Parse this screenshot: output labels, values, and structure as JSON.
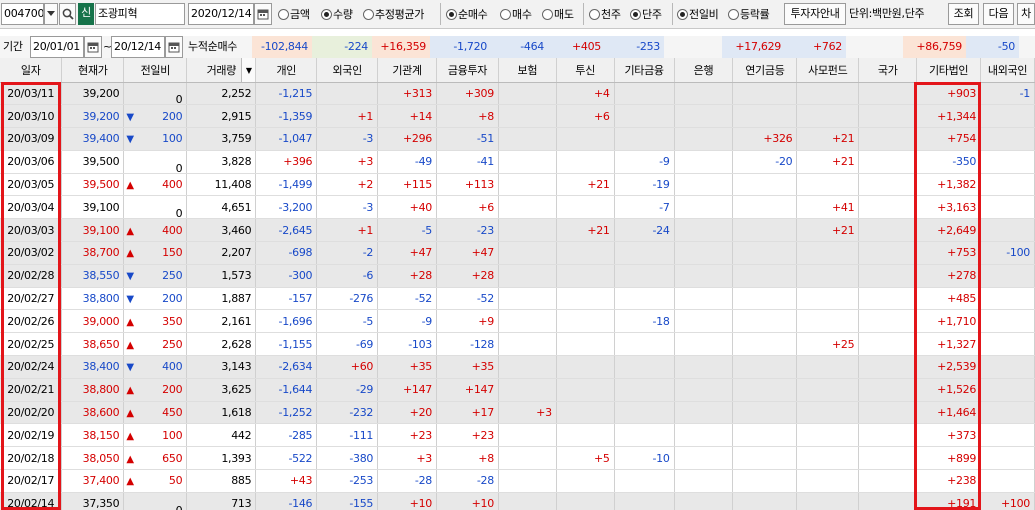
{
  "toolbar": {
    "code": "004700",
    "stock_badge": "신",
    "stock_name": "조광피혁",
    "date": "2020/12/14",
    "unit_options": [
      {
        "label": "금액",
        "on": false
      },
      {
        "label": "수량",
        "on": true
      },
      {
        "label": "추정평균가",
        "on": false
      }
    ],
    "trade_options": [
      {
        "label": "순매수",
        "on": true
      },
      {
        "label": "매수",
        "on": false
      },
      {
        "label": "매도",
        "on": false
      }
    ],
    "qty_options": [
      {
        "label": "천주",
        "on": false
      },
      {
        "label": "단주",
        "on": true
      }
    ],
    "compare_options": [
      {
        "label": "전일비",
        "on": true
      },
      {
        "label": "등락률",
        "on": false
      }
    ],
    "investor_info_button": "투자자안내",
    "unit_text": "단위:백만원,단주",
    "search_button": "조회",
    "next_button": "다음",
    "chart_button": "차"
  },
  "period": {
    "label": "기간",
    "from": "20/01/01",
    "tilde": "~",
    "to": "20/12/14",
    "cumulative_label": "누적순매수",
    "totals": [
      "-102,844",
      "-224",
      "+16,359",
      "-1,720",
      "-464",
      "+405",
      "-253",
      "",
      "+17,629",
      "+762",
      "",
      "+86,759",
      "-50"
    ]
  },
  "columns": [
    "일자",
    "현재가",
    "전일비",
    "거래량",
    "개인",
    "외국인",
    "기관계",
    "금융투자",
    "보험",
    "투신",
    "기타금융",
    "은행",
    "연기금등",
    "사모펀드",
    "국가",
    "기타법인",
    "내외국인"
  ],
  "rows": [
    [
      "20/03/11",
      "39,200",
      "",
      "0",
      "2,252",
      "-1,215",
      "",
      "+313",
      "+309",
      "",
      "+4",
      "",
      "",
      "",
      "",
      "",
      "+903",
      "-1"
    ],
    [
      "20/03/10",
      "39,200",
      "dn",
      "200",
      "2,915",
      "-1,359",
      "+1",
      "+14",
      "+8",
      "",
      "+6",
      "",
      "",
      "",
      "",
      "",
      "+1,344",
      ""
    ],
    [
      "20/03/09",
      "39,400",
      "dn",
      "100",
      "3,759",
      "-1,047",
      "-3",
      "+296",
      "-51",
      "",
      "",
      "",
      "",
      "+326",
      "+21",
      "",
      "+754",
      ""
    ],
    [
      "20/03/06",
      "39,500",
      "",
      "0",
      "3,828",
      "+396",
      "+3",
      "-49",
      "-41",
      "",
      "",
      "-9",
      "",
      "-20",
      "+21",
      "",
      "-350",
      ""
    ],
    [
      "20/03/05",
      "39,500",
      "up",
      "400",
      "11,408",
      "-1,499",
      "+2",
      "+115",
      "+113",
      "",
      "+21",
      "-19",
      "",
      "",
      "",
      "",
      "+1,382",
      ""
    ],
    [
      "20/03/04",
      "39,100",
      "",
      "0",
      "4,651",
      "-3,200",
      "-3",
      "+40",
      "+6",
      "",
      "",
      "-7",
      "",
      "",
      "+41",
      "",
      "+3,163",
      ""
    ],
    [
      "20/03/03",
      "39,100",
      "up",
      "400",
      "3,460",
      "-2,645",
      "+1",
      "-5",
      "-23",
      "",
      "+21",
      "-24",
      "",
      "",
      "+21",
      "",
      "+2,649",
      ""
    ],
    [
      "20/03/02",
      "38,700",
      "up",
      "150",
      "2,207",
      "-698",
      "-2",
      "+47",
      "+47",
      "",
      "",
      "",
      "",
      "",
      "",
      "",
      "+753",
      "-100"
    ],
    [
      "20/02/28",
      "38,550",
      "dn",
      "250",
      "1,573",
      "-300",
      "-6",
      "+28",
      "+28",
      "",
      "",
      "",
      "",
      "",
      "",
      "",
      "+278",
      ""
    ],
    [
      "20/02/27",
      "38,800",
      "dn",
      "200",
      "1,887",
      "-157",
      "-276",
      "-52",
      "-52",
      "",
      "",
      "",
      "",
      "",
      "",
      "",
      "+485",
      ""
    ],
    [
      "20/02/26",
      "39,000",
      "up",
      "350",
      "2,161",
      "-1,696",
      "-5",
      "-9",
      "+9",
      "",
      "",
      "-18",
      "",
      "",
      "",
      "",
      "+1,710",
      ""
    ],
    [
      "20/02/25",
      "38,650",
      "up",
      "250",
      "2,628",
      "-1,155",
      "-69",
      "-103",
      "-128",
      "",
      "",
      "",
      "",
      "",
      "+25",
      "",
      "+1,327",
      ""
    ],
    [
      "20/02/24",
      "38,400",
      "dn",
      "400",
      "3,143",
      "-2,634",
      "+60",
      "+35",
      "+35",
      "",
      "",
      "",
      "",
      "",
      "",
      "",
      "+2,539",
      ""
    ],
    [
      "20/02/21",
      "38,800",
      "up",
      "200",
      "3,625",
      "-1,644",
      "-29",
      "+147",
      "+147",
      "",
      "",
      "",
      "",
      "",
      "",
      "",
      "+1,526",
      ""
    ],
    [
      "20/02/20",
      "38,600",
      "up",
      "450",
      "1,618",
      "-1,252",
      "-232",
      "+20",
      "+17",
      "+3",
      "",
      "",
      "",
      "",
      "",
      "",
      "+1,464",
      ""
    ],
    [
      "20/02/19",
      "38,150",
      "up",
      "100",
      "442",
      "-285",
      "-111",
      "+23",
      "+23",
      "",
      "",
      "",
      "",
      "",
      "",
      "",
      "+373",
      ""
    ],
    [
      "20/02/18",
      "38,050",
      "up",
      "650",
      "1,393",
      "-522",
      "-380",
      "+3",
      "+8",
      "",
      "+5",
      "-10",
      "",
      "",
      "",
      "",
      "+899",
      ""
    ],
    [
      "20/02/17",
      "37,400",
      "up",
      "50",
      "885",
      "+43",
      "-253",
      "-28",
      "-28",
      "",
      "",
      "",
      "",
      "",
      "",
      "",
      "+238",
      ""
    ],
    [
      "20/02/14",
      "37,350",
      "",
      "0",
      "713",
      "-146",
      "-155",
      "+10",
      "+10",
      "",
      "",
      "",
      "",
      "",
      "",
      "",
      "+191",
      "+100"
    ]
  ],
  "alt_rows": [
    0,
    1,
    2,
    6,
    7,
    8,
    12,
    13,
    14,
    18
  ],
  "colors": {
    "up": "#d40000",
    "down": "#1849c8",
    "highlight": "#e3151a"
  },
  "icons": {
    "dropdown": "chevron-down-icon",
    "search": "search-icon",
    "calendar": "calendar-icon",
    "sort": "sort-triangle-icon"
  }
}
